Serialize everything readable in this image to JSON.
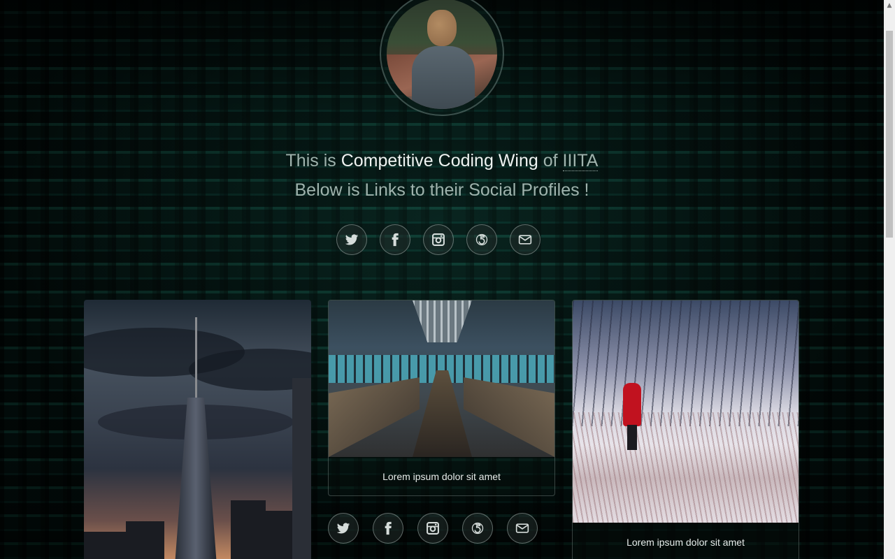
{
  "hero": {
    "headline_prefix": "This is ",
    "headline_strong": "Competitive Coding Wing",
    "headline_mid": " of ",
    "headline_abbr": "IIITA",
    "subline": "Below is Links to their Social Profiles !"
  },
  "social": [
    {
      "name": "twitter",
      "icon": "twitter-icon"
    },
    {
      "name": "facebook",
      "icon": "facebook-icon"
    },
    {
      "name": "instagram",
      "icon": "instagram-icon"
    },
    {
      "name": "500px",
      "icon": "500px-icon"
    },
    {
      "name": "email",
      "icon": "envelope-icon"
    }
  ],
  "cards": [
    {
      "image": "city skyline at dusk",
      "caption": ""
    },
    {
      "image": "subway escalator",
      "caption": "Lorem ipsum dolor sit amet"
    },
    {
      "image": "person in red coat in snowy field",
      "caption": "Lorem ipsum dolor sit amet"
    }
  ],
  "colors": {
    "accent_text": "#eef3f1",
    "muted_text": "#9fb3ad",
    "background": "#061311"
  }
}
